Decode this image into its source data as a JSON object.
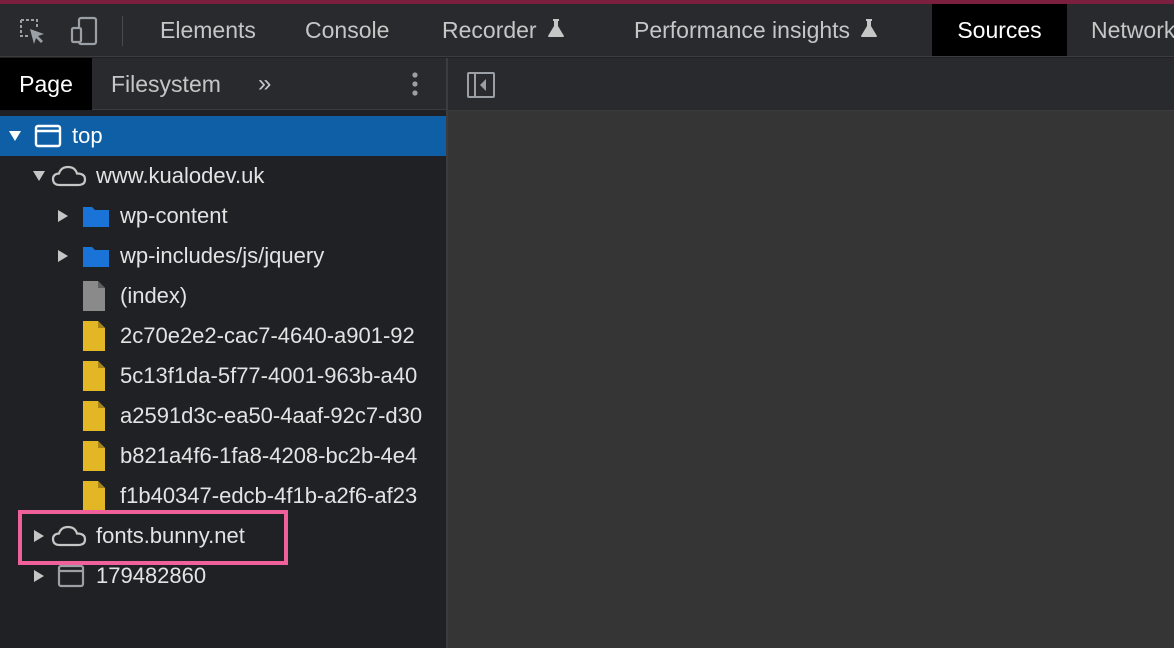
{
  "devtools": {
    "tabs": [
      "Elements",
      "Console",
      "Recorder",
      "Performance insights",
      "Sources",
      "Network"
    ],
    "active_tab": "Sources",
    "experimental_tabs": [
      "Recorder",
      "Performance insights"
    ]
  },
  "sources": {
    "subtabs": [
      "Page",
      "Filesystem"
    ],
    "active_subtab": "Page",
    "more_tabs_glyph": "»",
    "tree": [
      {
        "label": "top",
        "type": "frame",
        "expanded": true,
        "selected": true
      },
      {
        "label": "www.kualodev.uk",
        "type": "domain",
        "expanded": true
      },
      {
        "label": "wp-content",
        "type": "folder",
        "expanded": false
      },
      {
        "label": "wp-includes/js/jquery",
        "type": "folder",
        "expanded": false
      },
      {
        "label": "(index)",
        "type": "document"
      },
      {
        "label": "2c70e2e2-cac7-4640-a901-92",
        "type": "script"
      },
      {
        "label": "5c13f1da-5f77-4001-963b-a40",
        "type": "script"
      },
      {
        "label": "a2591d3c-ea50-4aaf-92c7-d30",
        "type": "script"
      },
      {
        "label": "b821a4f6-1fa8-4208-bc2b-4e4",
        "type": "script"
      },
      {
        "label": "f1b40347-edcb-4f1b-a2f6-af23",
        "type": "script"
      },
      {
        "label": "fonts.bunny.net",
        "type": "domain",
        "expanded": false,
        "highlighted": true
      },
      {
        "label": "179482860",
        "type": "frame",
        "expanded": false
      }
    ]
  },
  "colors": {
    "accent_bar": "#7a1f3d",
    "selection": "#0e5fa5",
    "folder": "#1a73d6",
    "script_file": "#e2b624",
    "document_file": "#8a8a8a",
    "highlight_box": "#f0609a"
  },
  "icons": {
    "inspect": "inspect-element-icon",
    "device": "device-toolbar-icon",
    "experimental": "flask-icon",
    "more": "kebab-menu-icon",
    "sidebar_toggle": "show-navigator-icon"
  }
}
